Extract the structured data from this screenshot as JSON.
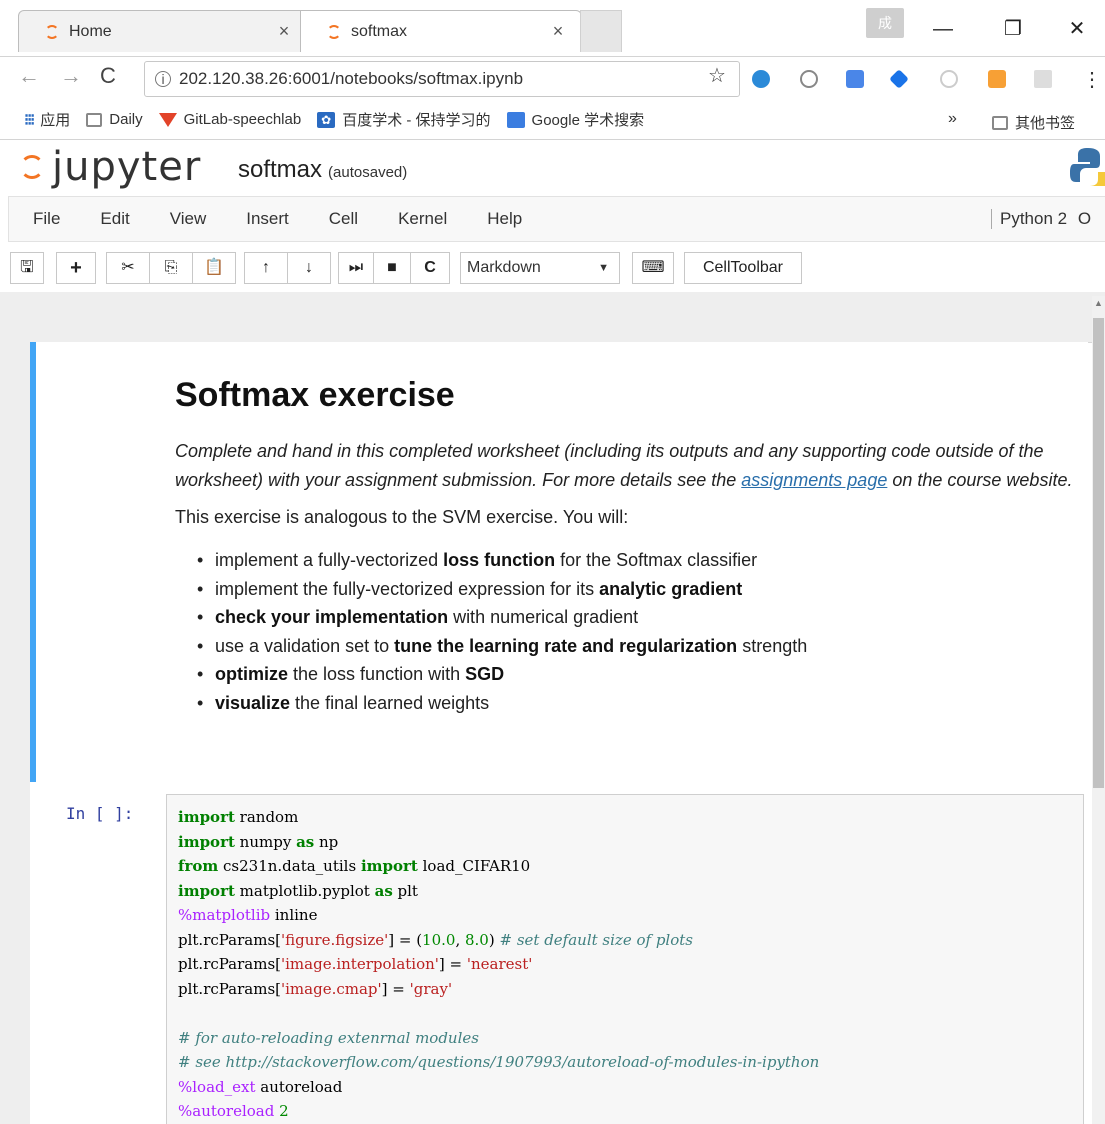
{
  "browser": {
    "tabs": [
      {
        "title": "Home",
        "close": "×"
      },
      {
        "title": "softmax",
        "close": "×"
      }
    ],
    "window_badge": "成",
    "window_controls": {
      "minimize": "—",
      "restore": "❐",
      "close": "✕"
    },
    "url": "202.120.38.26:6001/notebooks/softmax.ipynb",
    "bookmarks": [
      {
        "label": "应用"
      },
      {
        "label": "Daily"
      },
      {
        "label": "GitLab-speechlab"
      },
      {
        "label": "百度学术 - 保持学习的"
      },
      {
        "label": "Google 学术搜索"
      }
    ],
    "bookmarks_more": "»",
    "bookmarks_other": "其他书签"
  },
  "jupyter": {
    "logo": "jupyter",
    "notebook_name": "softmax",
    "autosave": "(autosaved)",
    "menu": [
      "File",
      "Edit",
      "View",
      "Insert",
      "Cell",
      "Kernel",
      "Help"
    ],
    "kernel": "Python 2",
    "kernel_indicator": "O",
    "cell_type": "Markdown",
    "celltoolbar_label": "CellToolbar"
  },
  "markdown": {
    "title": "Softmax exercise",
    "intro_before_link": "Complete and hand in this completed worksheet (including its outputs and any supporting code outside of the worksheet) with your assignment submission. For more details see the ",
    "intro_link": "assignments page",
    "intro_after_link": " on the course website.",
    "analogous": "This exercise is analogous to the SVM exercise. You will:",
    "bullets": [
      {
        "pre": "implement a fully-vectorized ",
        "bold": "loss function",
        "post": " for the Softmax classifier"
      },
      {
        "pre": "implement the fully-vectorized expression for its ",
        "bold": "analytic gradient",
        "post": ""
      },
      {
        "pre": "",
        "bold": "check your implementation",
        "post": " with numerical gradient"
      },
      {
        "pre": "use a validation set to ",
        "bold": "tune the learning rate and regularization",
        "post": " strength"
      },
      {
        "pre": "",
        "bold": "optimize",
        "post": " the loss function with "
      },
      {
        "pre": "",
        "bold": "visualize",
        "post": " the final learned weights"
      }
    ],
    "bullet5_suffix_bold": "SGD"
  },
  "code_cell": {
    "prompt": "In [ ]:",
    "lines": [
      "import random",
      "import numpy as np",
      "from cs231n.data_utils import load_CIFAR10",
      "import matplotlib.pyplot as plt",
      "%matplotlib inline",
      "plt.rcParams['figure.figsize'] = (10.0, 8.0) # set default size of plots",
      "plt.rcParams['image.interpolation'] = 'nearest'",
      "plt.rcParams['image.cmap'] = 'gray'",
      "",
      "# for auto-reloading extenrnal modules",
      "# see http://stackoverflow.com/questions/1907993/autoreload-of-modules-in-ipython",
      "%load_ext autoreload",
      "%autoreload 2"
    ]
  },
  "colors": {
    "selected_cell_border": "#42a5f5",
    "jupyter_orange": "#f37524",
    "link": "#296eaa"
  }
}
